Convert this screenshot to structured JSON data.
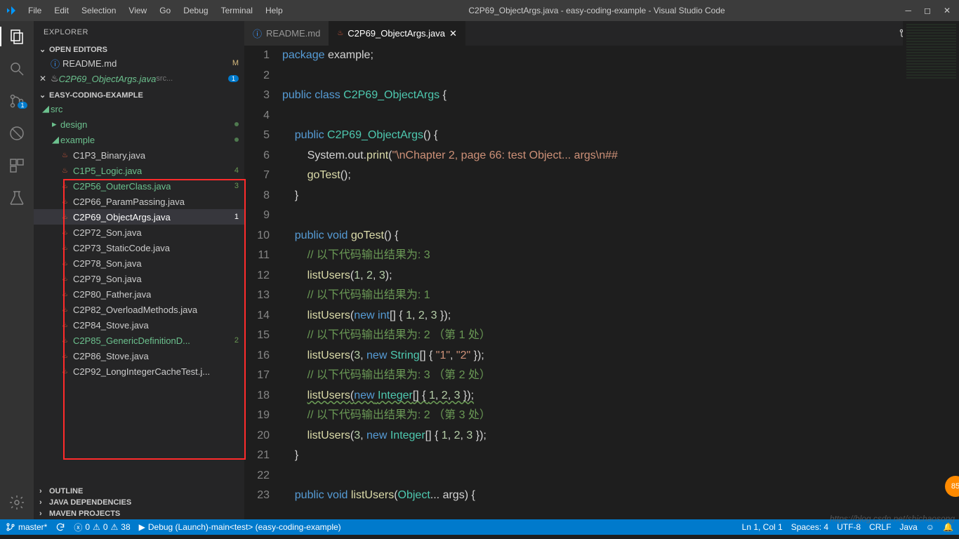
{
  "title": "C2P69_ObjectArgs.java - easy-coding-example - Visual Studio Code",
  "menu": [
    "File",
    "Edit",
    "Selection",
    "View",
    "Go",
    "Debug",
    "Terminal",
    "Help"
  ],
  "activity_badge": "1",
  "explorer": {
    "title": "EXPLORER",
    "open_editors_label": "OPEN EDITORS",
    "editors": [
      {
        "name": "README.md",
        "status": "M",
        "dirty": false,
        "type": "info"
      },
      {
        "name": "C2P69_ObjectArgs.java",
        "path": "src...",
        "badge": "1",
        "dirty": true,
        "type": "java",
        "italic": true
      }
    ],
    "project_label": "EASY-CODING-EXAMPLE",
    "tree": [
      {
        "name": "src",
        "indent": 0,
        "type": "folder-open",
        "green": true
      },
      {
        "name": "design",
        "indent": 1,
        "type": "folder",
        "green": true,
        "dot": true
      },
      {
        "name": "example",
        "indent": 1,
        "type": "folder-open",
        "green": true,
        "dot": true
      },
      {
        "name": "C1P3_Binary.java",
        "indent": 2,
        "type": "java"
      },
      {
        "name": "C1P5_Logic.java",
        "indent": 2,
        "type": "java",
        "green": true,
        "num": "4"
      },
      {
        "name": "C2P56_OuterClass.java",
        "indent": 2,
        "type": "java",
        "green": true,
        "num": "3"
      },
      {
        "name": "C2P66_ParamPassing.java",
        "indent": 2,
        "type": "java"
      },
      {
        "name": "C2P69_ObjectArgs.java",
        "indent": 2,
        "type": "java",
        "sel": true,
        "num_white": "1"
      },
      {
        "name": "C2P72_Son.java",
        "indent": 2,
        "type": "java"
      },
      {
        "name": "C2P73_StaticCode.java",
        "indent": 2,
        "type": "java"
      },
      {
        "name": "C2P78_Son.java",
        "indent": 2,
        "type": "java"
      },
      {
        "name": "C2P79_Son.java",
        "indent": 2,
        "type": "java"
      },
      {
        "name": "C2P80_Father.java",
        "indent": 2,
        "type": "java"
      },
      {
        "name": "C2P82_OverloadMethods.java",
        "indent": 2,
        "type": "java"
      },
      {
        "name": "C2P84_Stove.java",
        "indent": 2,
        "type": "java"
      },
      {
        "name": "C2P85_GenericDefinitionD...",
        "indent": 2,
        "type": "java",
        "green": true,
        "num": "2"
      },
      {
        "name": "C2P86_Stove.java",
        "indent": 2,
        "type": "java"
      },
      {
        "name": "C2P92_LongIntegerCacheTest.j...",
        "indent": 2,
        "type": "java"
      }
    ],
    "sections": [
      "OUTLINE",
      "JAVA DEPENDENCIES",
      "MAVEN PROJECTS"
    ]
  },
  "tabs": [
    {
      "label": "README.md",
      "type": "info",
      "active": false
    },
    {
      "label": "C2P69_ObjectArgs.java",
      "type": "java",
      "active": true,
      "close": true
    }
  ],
  "code_lines": [
    {
      "n": 1,
      "html": "<span class='kw'>package</span> <span class='pkg'>example</span>;"
    },
    {
      "n": 2,
      "html": ""
    },
    {
      "n": 3,
      "html": "<span class='kw'>public</span> <span class='kw'>class</span> <span class='cls'>C2P69_ObjectArgs</span> {"
    },
    {
      "n": 4,
      "html": ""
    },
    {
      "n": 5,
      "html": "    <span class='kw'>public</span> <span class='cls'>C2P69_ObjectArgs</span>() {"
    },
    {
      "n": 6,
      "html": "        System.out.<span class='fn'>print</span>(<span class='str'>\"\\nChapter 2, page 66: test Object... args\\n##</span>"
    },
    {
      "n": 7,
      "html": "        <span class='fn'>goTest</span>();"
    },
    {
      "n": 8,
      "html": "    }"
    },
    {
      "n": 9,
      "html": ""
    },
    {
      "n": 10,
      "html": "    <span class='kw'>public</span> <span class='kw'>void</span> <span class='fn'>goTest</span>() {"
    },
    {
      "n": 11,
      "html": "        <span class='cmt'>// 以下代码输出结果为: 3</span>"
    },
    {
      "n": 12,
      "html": "        <span class='fn'>listUsers</span>(<span class='num'>1</span>, <span class='num'>2</span>, <span class='num'>3</span>);"
    },
    {
      "n": 13,
      "html": "        <span class='cmt'>// 以下代码输出结果为: 1</span>"
    },
    {
      "n": 14,
      "html": "        <span class='fn'>listUsers</span>(<span class='kw'>new</span> <span class='kw'>int</span>[] { <span class='num'>1</span>, <span class='num'>2</span>, <span class='num'>3</span> });"
    },
    {
      "n": 15,
      "html": "        <span class='cmt'>// 以下代码输出结果为: 2 （第 1 处）</span>"
    },
    {
      "n": 16,
      "html": "        <span class='fn'>listUsers</span>(<span class='num'>3</span>, <span class='kw'>new</span> <span class='cls'>String</span>[] { <span class='str'>\"1\"</span>, <span class='str'>\"2\"</span> });"
    },
    {
      "n": 17,
      "html": "        <span class='cmt'>// 以下代码输出结果为: 3 （第 2 处）</span>"
    },
    {
      "n": 18,
      "html": "        <span class='underline-wavy'><span class='fn'>listUsers</span>(<span class='kw'>new</span> <span class='cls'>Integer</span>[] { <span class='num'>1</span>, <span class='num'>2</span>, <span class='num'>3</span> });</span>"
    },
    {
      "n": 19,
      "html": "        <span class='cmt'>// 以下代码输出结果为: 2 （第 3 处）</span>"
    },
    {
      "n": 20,
      "html": "        <span class='fn'>listUsers</span>(<span class='num'>3</span>, <span class='kw'>new</span> <span class='cls'>Integer</span>[] { <span class='num'>1</span>, <span class='num'>2</span>, <span class='num'>3</span> });"
    },
    {
      "n": 21,
      "html": "    }"
    },
    {
      "n": 22,
      "html": ""
    },
    {
      "n": 23,
      "html": "    <span class='kw'>public</span> <span class='kw'>void</span> <span class='fn'>listUsers</span>(<span class='cls'>Object</span>... args) {"
    }
  ],
  "status": {
    "branch": "master*",
    "sync": "",
    "errors": "0",
    "warn1": "0",
    "warn2": "38",
    "debug": "Debug (Launch)-main<test> (easy-coding-example)",
    "pos": "Ln 1, Col 1",
    "spaces": "Spaces: 4",
    "enc": "UTF-8",
    "eol": "CRLF",
    "lang": "Java"
  },
  "watermark": "https://blog.csdn.net/shichaosong",
  "pill": "85"
}
